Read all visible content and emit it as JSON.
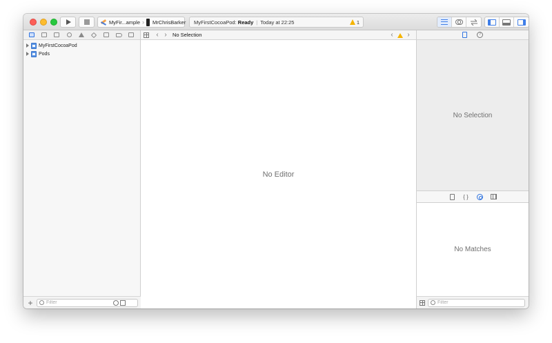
{
  "toolbar": {
    "scheme_target": "MyFir...ample",
    "scheme_device": "MrChrisBarker",
    "activity_project": "MyFirstCocoaPod:",
    "activity_status": "Ready",
    "activity_time": "Today at 22:25",
    "warning_count": "1"
  },
  "navigator": {
    "items": [
      {
        "label": "MyFirstCocoaPod"
      },
      {
        "label": "Pods"
      }
    ],
    "filter_placeholder": "Filter"
  },
  "jumpbar": {
    "title": "No Selection"
  },
  "editor": {
    "placeholder": "No Editor"
  },
  "inspector": {
    "placeholder": "No Selection"
  },
  "library": {
    "placeholder": "No Matches",
    "filter_placeholder": "Filter"
  },
  "colors": {
    "accent": "#2f73e0",
    "warning": "#f5b400",
    "close": "#fc5f57",
    "minimize": "#fdbc2e",
    "zoom": "#28c840"
  }
}
